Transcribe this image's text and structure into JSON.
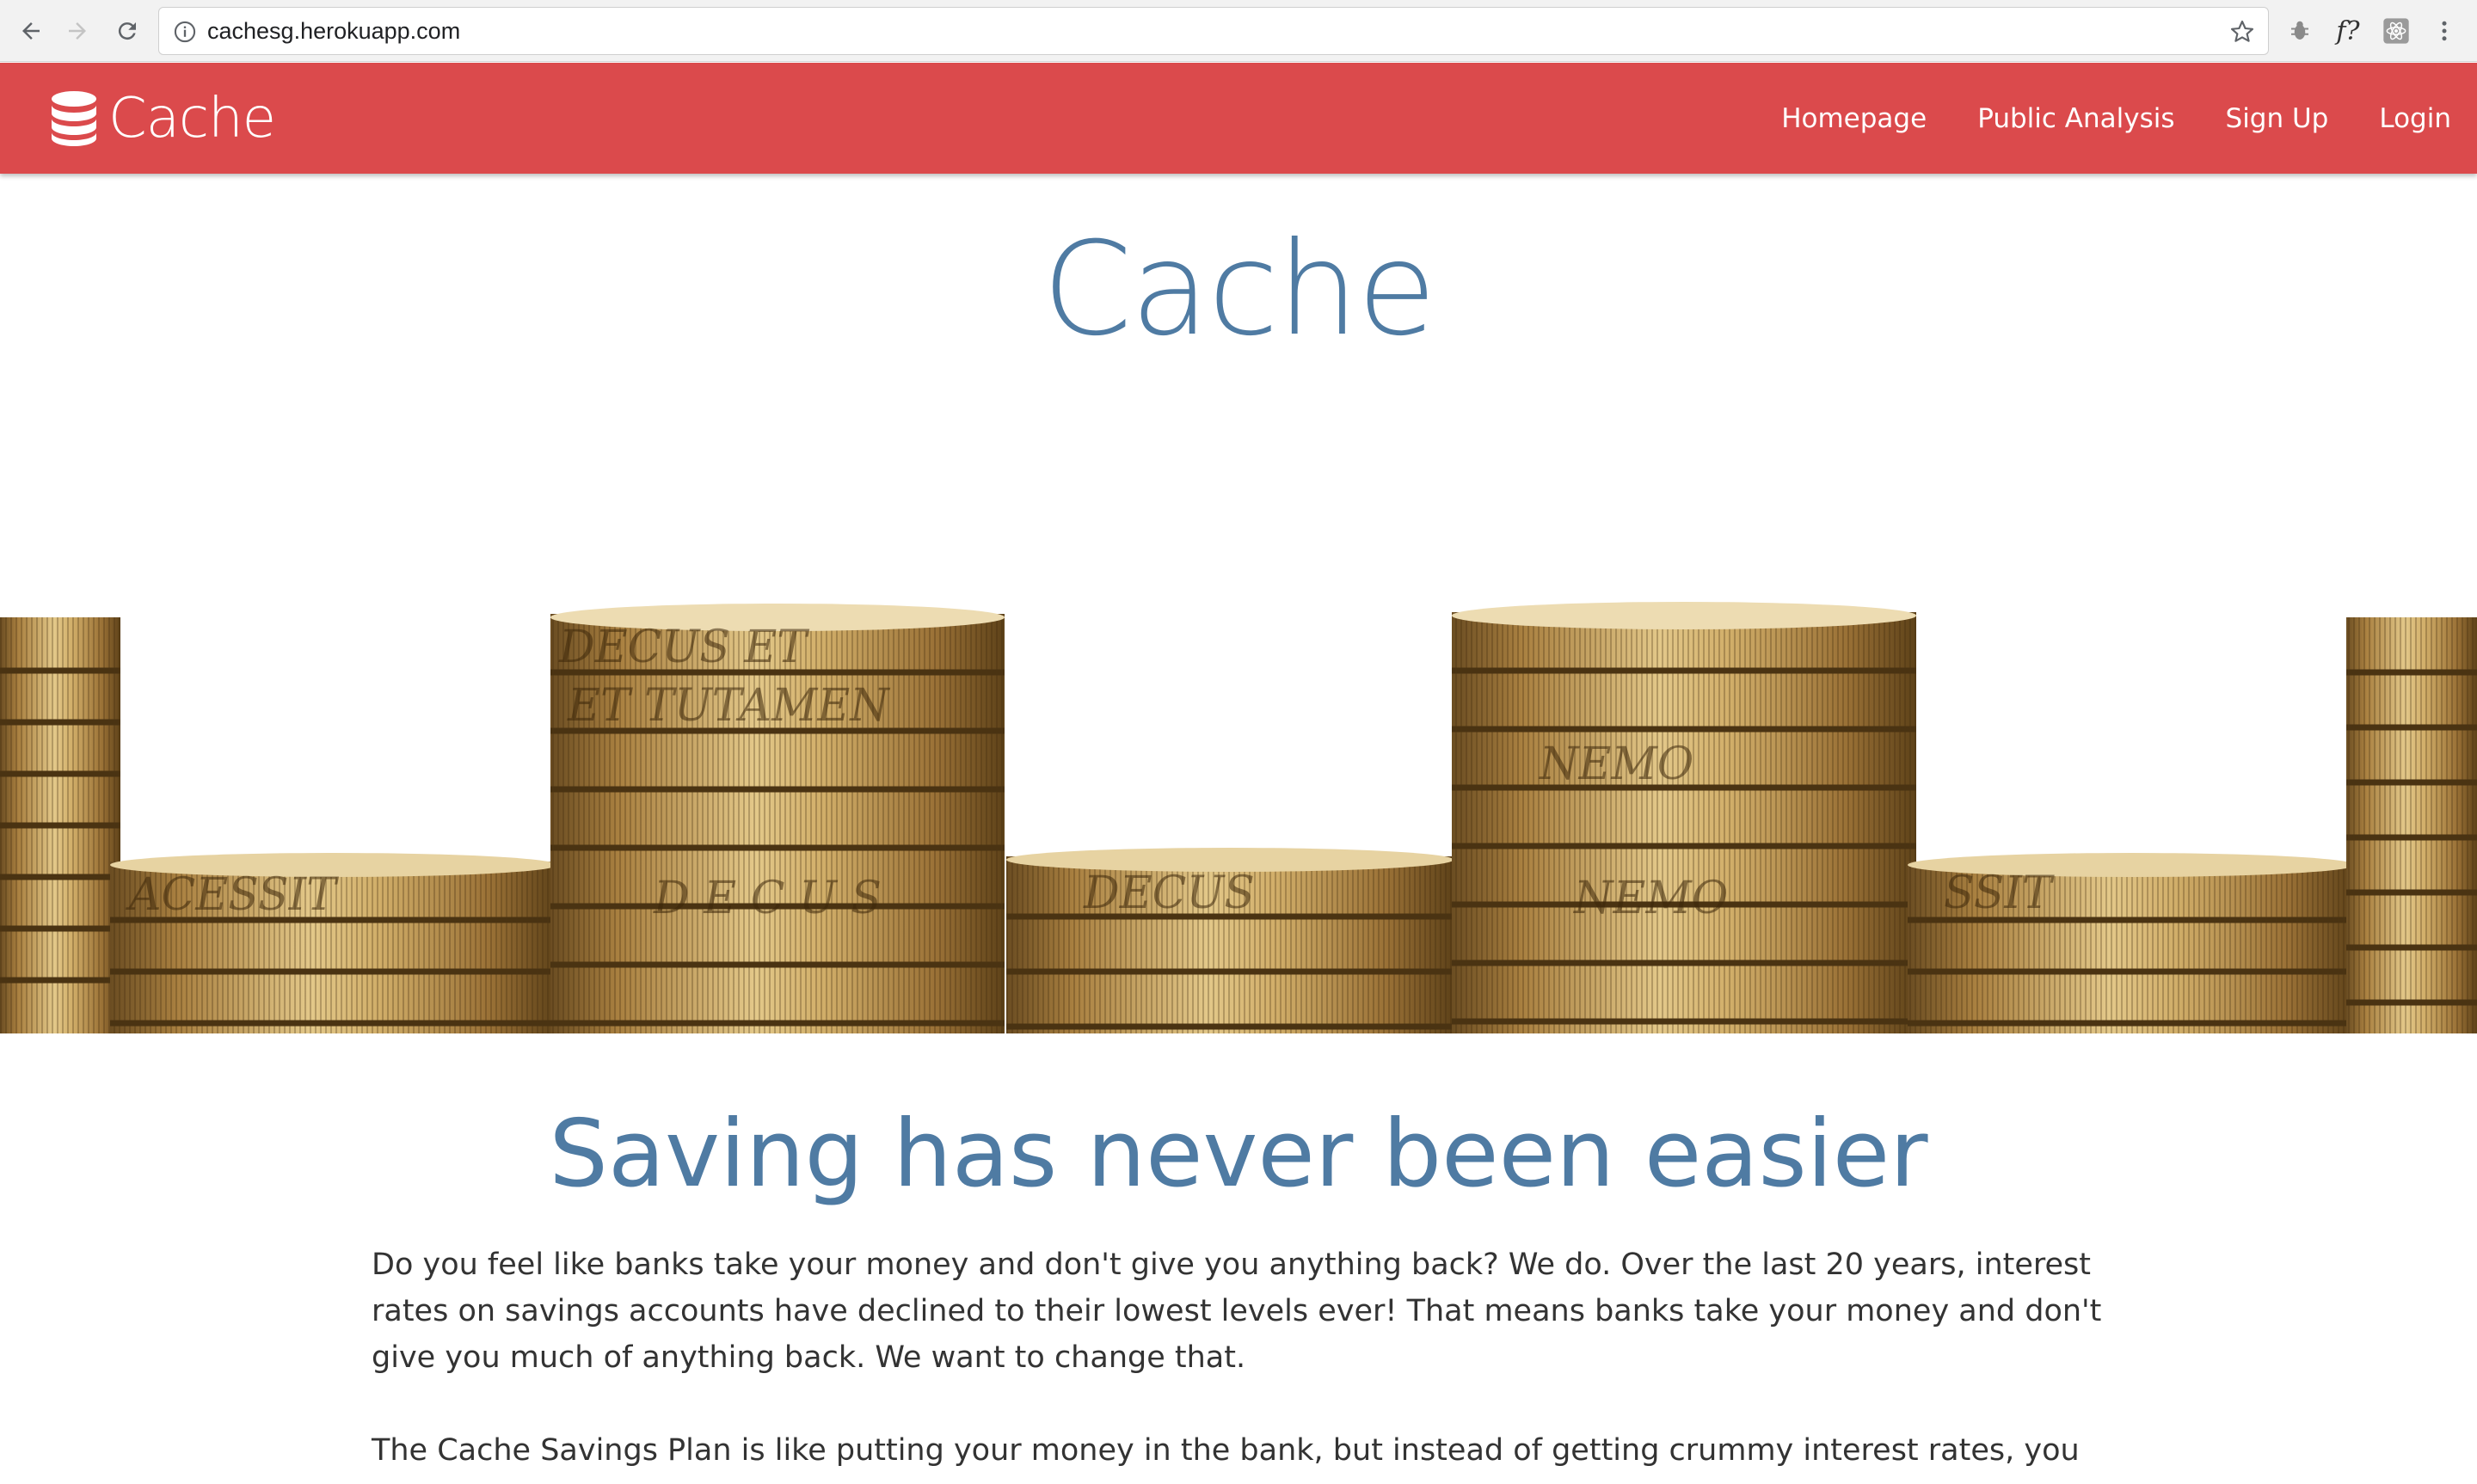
{
  "browser": {
    "url": "cachesg.herokuapp.com",
    "extension_label": "f?"
  },
  "navbar": {
    "brand": "Cache",
    "items": [
      {
        "label": "Homepage"
      },
      {
        "label": "Public Analysis"
      },
      {
        "label": "Sign Up"
      },
      {
        "label": "Login"
      }
    ],
    "color": "#db4a4c"
  },
  "hero": {
    "title": "Cache"
  },
  "content": {
    "headline": "Saving has never been easier",
    "paragraph1": "Do you feel like banks take your money and don't give you anything back? We do. Over the last 20 years, interest rates on savings accounts have declined to their lowest levels ever! That means banks take your money and don't give you much of anything back. We want to change that.",
    "paragraph2": "The Cache Savings Plan is like putting your money in the bank, but instead of getting crummy interest rates, you get a"
  },
  "colors": {
    "accent": "#4f7ba3",
    "text": "#333333",
    "coin": "#b8904a"
  }
}
